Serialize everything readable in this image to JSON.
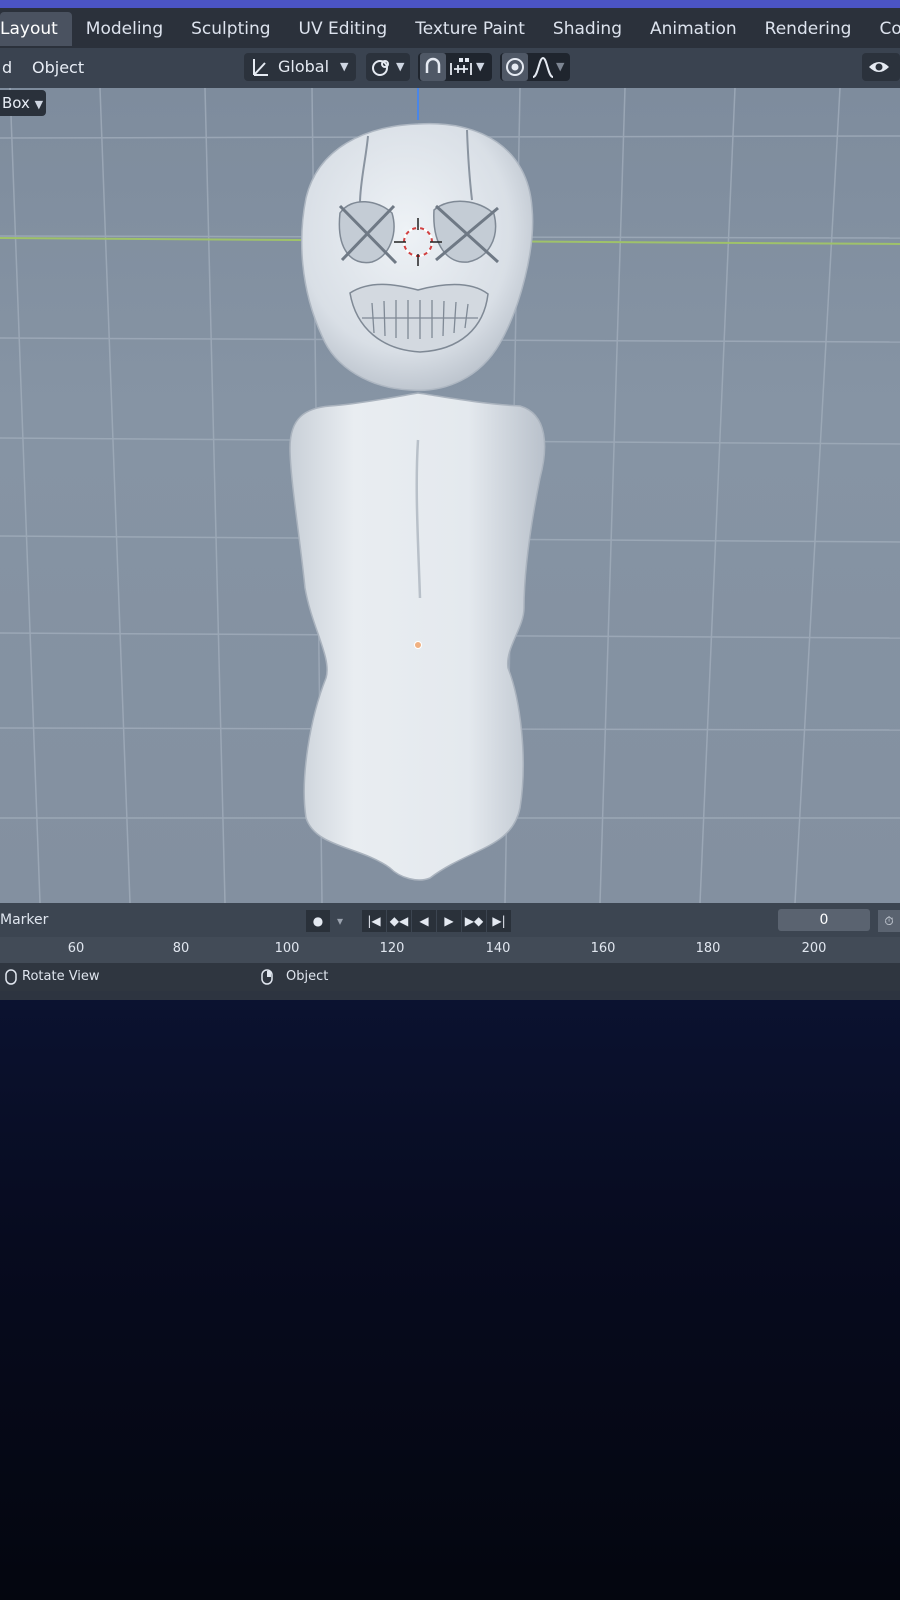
{
  "workspace_tabs": [
    {
      "label": "Layout",
      "active": true
    },
    {
      "label": "Modeling",
      "active": false
    },
    {
      "label": "Sculpting",
      "active": false
    },
    {
      "label": "UV Editing",
      "active": false
    },
    {
      "label": "Texture Paint",
      "active": false
    },
    {
      "label": "Shading",
      "active": false
    },
    {
      "label": "Animation",
      "active": false
    },
    {
      "label": "Rendering",
      "active": false
    },
    {
      "label": "Compositing",
      "active": false
    }
  ],
  "header": {
    "menu_partial": "d",
    "menu_object": "Object",
    "transform_orientation": "Global"
  },
  "viewport": {
    "select_mode": "Box"
  },
  "timeline": {
    "marker_label": "Marker",
    "current_frame": "0",
    "ruler_ticks": [
      "60",
      "80",
      "100",
      "120",
      "140",
      "160",
      "180",
      "200"
    ]
  },
  "status_bar": {
    "left_hint": "Rotate View",
    "mid_hint": "Object"
  },
  "colors": {
    "accent": "#4b54c4",
    "viewport_bg": "#8390a0",
    "x_axis": "#9fc26a",
    "z_axis": "#4a86e8"
  }
}
